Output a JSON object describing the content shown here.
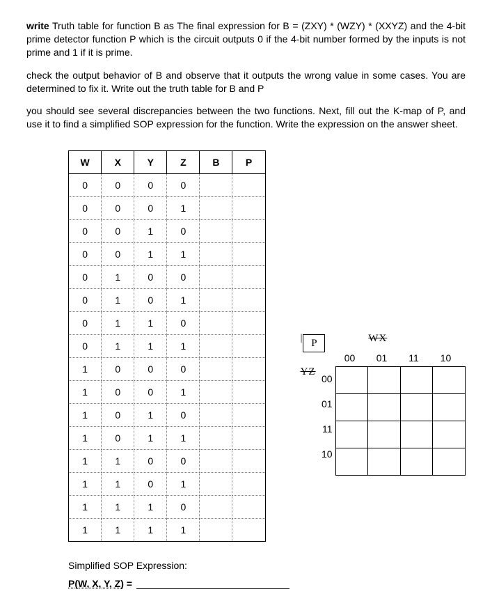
{
  "para1_parts": {
    "prefix": "write",
    "body": " Truth table for function B as The final expression for B = (ZXY) * (WZY) * (XXYZ) and the 4-bit prime detector function P which is the circuit outputs 0 if the 4-bit number formed by the inputs is not prime and 1 if it is prime."
  },
  "para2": "check the output behavior of B and observe that it outputs the wrong value in some cases. You are determined to fix it. Write out the truth table for B and P",
  "para3": "you should see several discrepancies between the two functions. Next, fill out the K-map of P, and use it to find a simplified SOP expression for the function. Write the expression on the answer sheet.",
  "truth_headers": [
    "W",
    "X",
    "Y",
    "Z",
    "B",
    "P"
  ],
  "truth_rows": [
    [
      "0",
      "0",
      "0",
      "0",
      "",
      ""
    ],
    [
      "0",
      "0",
      "0",
      "1",
      "",
      ""
    ],
    [
      "0",
      "0",
      "1",
      "0",
      "",
      ""
    ],
    [
      "0",
      "0",
      "1",
      "1",
      "",
      ""
    ],
    [
      "0",
      "1",
      "0",
      "0",
      "",
      ""
    ],
    [
      "0",
      "1",
      "0",
      "1",
      "",
      ""
    ],
    [
      "0",
      "1",
      "1",
      "0",
      "",
      ""
    ],
    [
      "0",
      "1",
      "1",
      "1",
      "",
      ""
    ],
    [
      "1",
      "0",
      "0",
      "0",
      "",
      ""
    ],
    [
      "1",
      "0",
      "0",
      "1",
      "",
      ""
    ],
    [
      "1",
      "0",
      "1",
      "0",
      "",
      ""
    ],
    [
      "1",
      "0",
      "1",
      "1",
      "",
      ""
    ],
    [
      "1",
      "1",
      "0",
      "0",
      "",
      ""
    ],
    [
      "1",
      "1",
      "0",
      "1",
      "",
      ""
    ],
    [
      "1",
      "1",
      "1",
      "0",
      "",
      ""
    ],
    [
      "1",
      "1",
      "1",
      "1",
      "",
      ""
    ]
  ],
  "kmap": {
    "title": "P",
    "top_axis": "WX",
    "left_axis": "YZ",
    "cols": [
      "00",
      "01",
      "11",
      "10"
    ],
    "rows": [
      "00",
      "01",
      "11",
      "10"
    ]
  },
  "sop_label": "Simplified SOP Expression:",
  "sop_fn": "P(W, X, Y, Z)",
  "sop_eq": " = "
}
